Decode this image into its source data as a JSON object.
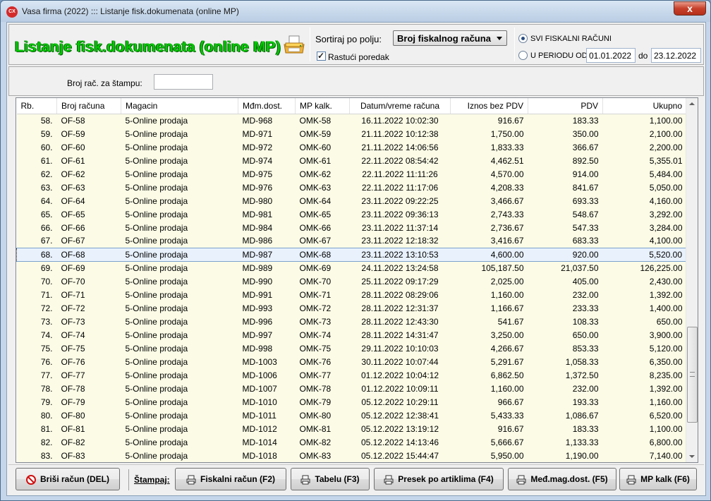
{
  "window": {
    "title": "Vasa firma (2022) ::: Listanje fisk.dokumenata (online MP)",
    "app_icon": "CX",
    "close_label": "x"
  },
  "header": {
    "title": "Listanje fisk.dokumenata (online MP)",
    "title_color": "#00c800",
    "sort_label": "Sortiraj po polju:",
    "sort_value": "Broj fiskalnog računa",
    "ascending_label": "Rastući poredak",
    "ascending_checked": true,
    "radio_all_label": "SVI FISKALNI RAČUNI",
    "radio_period_label": "U PERIODU OD:",
    "date_from": "01.01.2022",
    "date_to_label": "do",
    "date_to": "23.12.2022"
  },
  "filter": {
    "broj_label": "Broj rač. za štampu:",
    "broj_value": ""
  },
  "table": {
    "columns": [
      "Rb.",
      "Broj računa",
      "Magacin",
      "Mđm.dost.",
      "MP kalk.",
      "Datum/vreme računa",
      "Iznos bez PDV",
      "PDV",
      "Ukupno"
    ],
    "selected_index": 10,
    "rows": [
      [
        "58.",
        "OF-58",
        "5-Online prodaja",
        "MD-968",
        "OMK-58",
        "16.11.2022 10:02:30",
        "916.67",
        "183.33",
        "1,100.00"
      ],
      [
        "59.",
        "OF-59",
        "5-Online prodaja",
        "MD-971",
        "OMK-59",
        "21.11.2022 10:12:38",
        "1,750.00",
        "350.00",
        "2,100.00"
      ],
      [
        "60.",
        "OF-60",
        "5-Online prodaja",
        "MD-972",
        "OMK-60",
        "21.11.2022 14:06:56",
        "1,833.33",
        "366.67",
        "2,200.00"
      ],
      [
        "61.",
        "OF-61",
        "5-Online prodaja",
        "MD-974",
        "OMK-61",
        "22.11.2022 08:54:42",
        "4,462.51",
        "892.50",
        "5,355.01"
      ],
      [
        "62.",
        "OF-62",
        "5-Online prodaja",
        "MD-975",
        "OMK-62",
        "22.11.2022 11:11:26",
        "4,570.00",
        "914.00",
        "5,484.00"
      ],
      [
        "63.",
        "OF-63",
        "5-Online prodaja",
        "MD-976",
        "OMK-63",
        "22.11.2022 11:17:06",
        "4,208.33",
        "841.67",
        "5,050.00"
      ],
      [
        "64.",
        "OF-64",
        "5-Online prodaja",
        "MD-980",
        "OMK-64",
        "23.11.2022 09:22:25",
        "3,466.67",
        "693.33",
        "4,160.00"
      ],
      [
        "65.",
        "OF-65",
        "5-Online prodaja",
        "MD-981",
        "OMK-65",
        "23.11.2022 09:36:13",
        "2,743.33",
        "548.67",
        "3,292.00"
      ],
      [
        "66.",
        "OF-66",
        "5-Online prodaja",
        "MD-984",
        "OMK-66",
        "23.11.2022 11:37:14",
        "2,736.67",
        "547.33",
        "3,284.00"
      ],
      [
        "67.",
        "OF-67",
        "5-Online prodaja",
        "MD-986",
        "OMK-67",
        "23.11.2022 12:18:32",
        "3,416.67",
        "683.33",
        "4,100.00"
      ],
      [
        "68.",
        "OF-68",
        "5-Online prodaja",
        "MD-987",
        "OMK-68",
        "23.11.2022 13:10:53",
        "4,600.00",
        "920.00",
        "5,520.00"
      ],
      [
        "69.",
        "OF-69",
        "5-Online prodaja",
        "MD-989",
        "OMK-69",
        "24.11.2022 13:24:58",
        "105,187.50",
        "21,037.50",
        "126,225.00"
      ],
      [
        "70.",
        "OF-70",
        "5-Online prodaja",
        "MD-990",
        "OMK-70",
        "25.11.2022 09:17:29",
        "2,025.00",
        "405.00",
        "2,430.00"
      ],
      [
        "71.",
        "OF-71",
        "5-Online prodaja",
        "MD-991",
        "OMK-71",
        "28.11.2022 08:29:06",
        "1,160.00",
        "232.00",
        "1,392.00"
      ],
      [
        "72.",
        "OF-72",
        "5-Online prodaja",
        "MD-993",
        "OMK-72",
        "28.11.2022 12:31:37",
        "1,166.67",
        "233.33",
        "1,400.00"
      ],
      [
        "73.",
        "OF-73",
        "5-Online prodaja",
        "MD-996",
        "OMK-73",
        "28.11.2022 12:43:30",
        "541.67",
        "108.33",
        "650.00"
      ],
      [
        "74.",
        "OF-74",
        "5-Online prodaja",
        "MD-997",
        "OMK-74",
        "28.11.2022 14:31:47",
        "3,250.00",
        "650.00",
        "3,900.00"
      ],
      [
        "75.",
        "OF-75",
        "5-Online prodaja",
        "MD-998",
        "OMK-75",
        "29.11.2022 10:10:03",
        "4,266.67",
        "853.33",
        "5,120.00"
      ],
      [
        "76.",
        "OF-76",
        "5-Online prodaja",
        "MD-1003",
        "OMK-76",
        "30.11.2022 10:07:44",
        "5,291.67",
        "1,058.33",
        "6,350.00"
      ],
      [
        "77.",
        "OF-77",
        "5-Online prodaja",
        "MD-1006",
        "OMK-77",
        "01.12.2022 10:04:12",
        "6,862.50",
        "1,372.50",
        "8,235.00"
      ],
      [
        "78.",
        "OF-78",
        "5-Online prodaja",
        "MD-1007",
        "OMK-78",
        "01.12.2022 10:09:11",
        "1,160.00",
        "232.00",
        "1,392.00"
      ],
      [
        "79.",
        "OF-79",
        "5-Online prodaja",
        "MD-1010",
        "OMK-79",
        "05.12.2022 10:29:11",
        "966.67",
        "193.33",
        "1,160.00"
      ],
      [
        "80.",
        "OF-80",
        "5-Online prodaja",
        "MD-1011",
        "OMK-80",
        "05.12.2022 12:38:41",
        "5,433.33",
        "1,086.67",
        "6,520.00"
      ],
      [
        "81.",
        "OF-81",
        "5-Online prodaja",
        "MD-1012",
        "OMK-81",
        "05.12.2022 13:19:12",
        "916.67",
        "183.33",
        "1,100.00"
      ],
      [
        "82.",
        "OF-82",
        "5-Online prodaja",
        "MD-1014",
        "OMK-82",
        "05.12.2022 14:13:46",
        "5,666.67",
        "1,133.33",
        "6,800.00"
      ],
      [
        "83.",
        "OF-83",
        "5-Online prodaja",
        "MD-1018",
        "OMK-83",
        "05.12.2022 15:44:47",
        "5,950.00",
        "1,190.00",
        "7,140.00"
      ]
    ]
  },
  "bottom": {
    "delete_label": "Briši račun (DEL)",
    "print_label": "Štampaj:",
    "fiskalni_label": "Fiskalni račun (F2)",
    "tabelu_label": "Tabelu (F3)",
    "presek_label": "Presek po artiklima (F4)",
    "medmag_label": "Međ.mag.dost. (F5)",
    "mpkalk_label": "MP kalk (F6)"
  }
}
